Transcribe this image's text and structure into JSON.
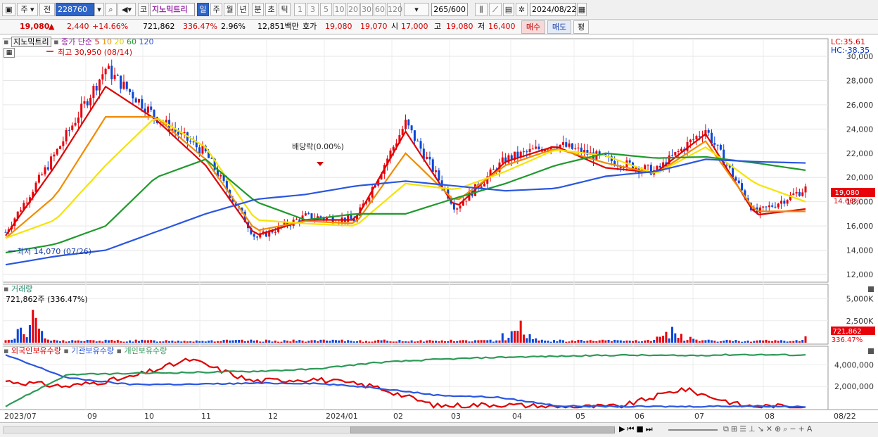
{
  "toolbar": {
    "code": "228760",
    "market_a": "주",
    "market_b": "전",
    "stock_name": "지노믹트리",
    "periods": [
      "일",
      "주",
      "월",
      "년",
      "분",
      "초",
      "틱"
    ],
    "selected_period": "일",
    "intervals": [
      "1",
      "3",
      "5",
      "10",
      "20",
      "30",
      "60",
      "120"
    ],
    "range_count": "265",
    "range_total": "/600",
    "date": "2024/08/22",
    "code_label": "코"
  },
  "quote": {
    "price": "19,080",
    "change": "2,440",
    "change_pct": "+14.66%",
    "volume": "721,862",
    "vol_ratio": "336.47%",
    "turnover_rate": "2.96%",
    "amount": "12,851백만",
    "bid_label": "호가",
    "ask": "19,080",
    "bid": "19,070",
    "open_label": "시",
    "open": "17,000",
    "high_label": "고",
    "high": "19,080",
    "low_label": "저",
    "low": "16,400",
    "buy_label": "매수",
    "sell_label": "매도",
    "eval_label": "평"
  },
  "price_panel": {
    "stock_label": "지노믹트리",
    "ma_label": "종가 단순",
    "ma_periods": [
      "5",
      "10",
      "20",
      "60",
      "120"
    ],
    "lc": "LC:35.61",
    "hc": "HC:-38.35",
    "max_note": "최고 30,950 (08/14)",
    "min_note": "최저 14,070 (07/26)",
    "dividend_note": "배당락(0.00%)",
    "last_price_tag": "19,080",
    "last_pct_tag": "14.66%",
    "y_ticks": [
      "30,000",
      "28,000",
      "26,000",
      "24,000",
      "22,000",
      "20,000",
      "18,000",
      "16,000",
      "14,000",
      "12,000"
    ]
  },
  "volume_panel": {
    "title": "거래량",
    "current": "721,862주 (336.47%)",
    "y_ticks": [
      "5,000K",
      "2,500K"
    ],
    "last_tag": "721,862",
    "last_pct_tag": "336.47%"
  },
  "holdings_panel": {
    "legend": [
      "외국인보유수량",
      "기관보유수량",
      "개인보유수량"
    ],
    "y_ticks": [
      "4,000,000",
      "2,000,000"
    ]
  },
  "x_axis": {
    "labels": [
      "2023/07",
      "09",
      "10",
      "11",
      "12",
      "2024/01",
      "02",
      "03",
      "04",
      "05",
      "06",
      "07",
      "08"
    ],
    "end_label": "08/22"
  },
  "colors": {
    "up": "#e8000b",
    "down": "#0a46d8",
    "ma5": "#e00000",
    "ma10": "#f08c00",
    "ma20": "#f4e400",
    "ma60": "#1f9a2c",
    "ma120": "#2a56e0",
    "foreign": "#e00000",
    "institution": "#2a56e0",
    "individual": "#2e9a58"
  },
  "chart_data": [
    {
      "type": "candlestick",
      "title": "지노믹트리",
      "x_range": [
        "2023/07/17",
        "2024/08/22"
      ],
      "ylim": [
        12000,
        31000
      ],
      "series": [
        {
          "name": "종가",
          "x": [
            "2023/07",
            "2023/08",
            "2023/08/14",
            "2023/09",
            "2023/10",
            "2023/11",
            "2023/12",
            "2024/01",
            "2024/01/22",
            "2024/02",
            "2024/03",
            "2024/04",
            "2024/05",
            "2024/06",
            "2024/07",
            "2024/08",
            "2024/08/22"
          ],
          "values": [
            15500,
            22000,
            29000,
            25000,
            22000,
            15000,
            16800,
            16500,
            24500,
            17500,
            21500,
            22800,
            21500,
            20500,
            24000,
            17000,
            19080
          ]
        },
        {
          "name": "5",
          "values": [
            15200,
            21000,
            27500,
            24800,
            21000,
            15200,
            16500,
            16500,
            23800,
            17500,
            21300,
            22600,
            20800,
            20400,
            23600,
            16900,
            17400
          ]
        },
        {
          "name": "10",
          "values": [
            15000,
            18500,
            25000,
            25000,
            21500,
            15600,
            16400,
            16200,
            22000,
            18000,
            21000,
            22400,
            21200,
            20300,
            23000,
            17200,
            17200
          ]
        },
        {
          "name": "20",
          "values": [
            15000,
            16500,
            21000,
            25000,
            22500,
            16500,
            16200,
            16000,
            19500,
            19000,
            20500,
            22300,
            21800,
            20300,
            22500,
            19500,
            18000
          ]
        },
        {
          "name": "60",
          "values": [
            13800,
            14500,
            16000,
            20000,
            21500,
            18000,
            16500,
            17000,
            17000,
            18300,
            19500,
            21000,
            22000,
            21600,
            21700,
            21200,
            20600
          ]
        },
        {
          "name": "120",
          "values": [
            12800,
            13500,
            14000,
            15500,
            17000,
            18200,
            18600,
            19300,
            19700,
            19300,
            18900,
            19100,
            20100,
            20500,
            21500,
            21300,
            21200
          ]
        }
      ],
      "annotations": {
        "high": "30,950 (08/14)",
        "low": "14,070 (07/26)",
        "dividend": "배당락(0.00%)"
      }
    },
    {
      "type": "bar",
      "title": "거래량",
      "ylim": [
        0,
        6000000
      ],
      "last_value": 721862,
      "peaks": [
        {
          "x": "2023/08",
          "value": 4200000
        },
        {
          "x": "2024/04",
          "value": 3100000
        },
        {
          "x": "2024/06",
          "value": 1900000
        }
      ]
    },
    {
      "type": "line",
      "title": "보유수량",
      "ylim": [
        0,
        5200000
      ],
      "x": [
        "2023/07",
        "2023/09",
        "2023/10",
        "2023/11",
        "2023/12",
        "2024/01",
        "2024/02",
        "2024/03",
        "2024/04",
        "2024/05",
        "2024/06",
        "2024/07",
        "2024/08",
        "2024/08/22"
      ],
      "series": [
        {
          "name": "외국인보유수량",
          "values": [
            2500000,
            2000000,
            2800000,
            4500000,
            2500000,
            2700000,
            2000000,
            200000,
            350000,
            100000,
            150000,
            1800000,
            200000,
            150000
          ]
        },
        {
          "name": "기관보유수량",
          "values": [
            4900000,
            2800000,
            2200000,
            2200000,
            2300000,
            2300000,
            1900000,
            1200000,
            1000000,
            200000,
            150000,
            150000,
            200000,
            150000
          ]
        },
        {
          "name": "개인보유수량",
          "values": [
            200000,
            3100000,
            3200000,
            3300000,
            3400000,
            3600000,
            4200000,
            4500000,
            4700000,
            4800000,
            4900000,
            4850000,
            4950000,
            4900000
          ]
        }
      ]
    }
  ]
}
